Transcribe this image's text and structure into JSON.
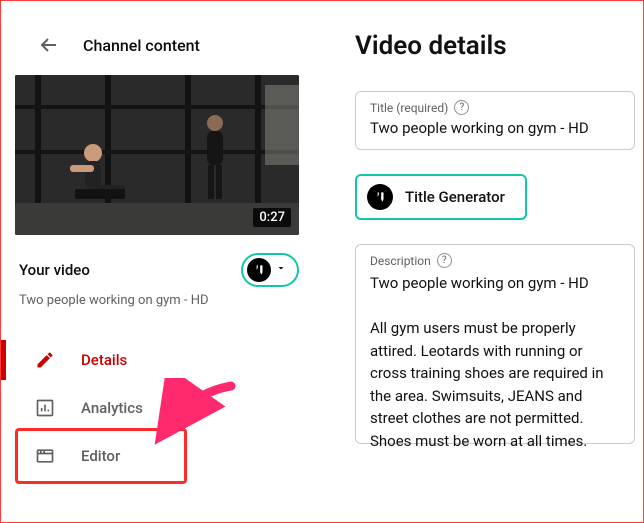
{
  "left": {
    "back_label": "Channel content",
    "thumbnail_duration": "0:27",
    "your_video_label": "Your video",
    "your_video_subtitle": "Two people working on gym - HD",
    "nav": [
      {
        "id": "details",
        "label": "Details",
        "icon": "pencil-icon",
        "active": true
      },
      {
        "id": "analytics",
        "label": "Analytics",
        "icon": "analytics-icon",
        "active": false
      },
      {
        "id": "editor",
        "label": "Editor",
        "icon": "editor-icon",
        "active": false
      }
    ]
  },
  "right": {
    "page_title": "Video details",
    "title_field": {
      "label": "Title (required)",
      "value": "Two people working on gym - HD"
    },
    "title_generator_label": "Title Generator",
    "description_field": {
      "label": "Description",
      "value": "Two people working on gym - HD\n\nAll gym users must be properly attired. Leotards with running or cross training shoes are required in the area. Swimsuits, JEANS and street clothes are not permitted. Shoes must be worn at all times."
    }
  },
  "annotation": {
    "target_nav_id": "editor"
  }
}
